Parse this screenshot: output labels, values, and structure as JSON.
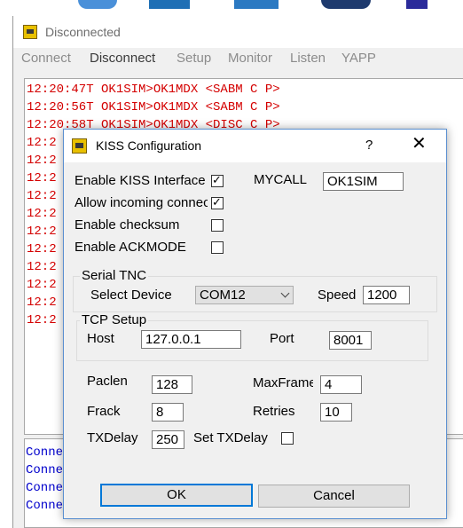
{
  "main_window": {
    "title": "Disconnected",
    "menu": [
      "Connect",
      "Disconnect",
      "Setup",
      "Monitor",
      "Listen",
      "YAPP"
    ],
    "log_lines": [
      "12:20:47T OK1SIM>OK1MDX <SABM C P>",
      "12:20:56T OK1SIM>OK1MDX <SABM C P>",
      "12:20:58T OK1SIM>OK1MDX <DISC C P>",
      "12:2",
      "12:2",
      "12:2",
      "12:2",
      "12:2",
      "12:2",
      "12:2",
      "12:2",
      "12:2",
      "12:2",
      "12:2"
    ],
    "conn_lines": [
      "Conne",
      "Conne",
      "Conne",
      "Conne"
    ]
  },
  "dialog": {
    "title": "KISS Configuration",
    "help": "?",
    "close": "✕",
    "enable_kiss": {
      "label": "Enable KISS Interface",
      "checked": true
    },
    "allow_incoming": {
      "label": "Allow incoming connections",
      "checked": true
    },
    "enable_checksum": {
      "label": "Enable checksum",
      "checked": false
    },
    "enable_ackmode": {
      "label": "Enable ACKMODE",
      "checked": false
    },
    "mycall_label": "MYCALL",
    "mycall_value": "OK1SIM",
    "serial_group": "Serial TNC",
    "select_device_label": "Select Device",
    "select_device_value": "COM12",
    "speed_label": "Speed",
    "speed_value": "1200",
    "tcp_group": "TCP  Setup",
    "host_label": "Host",
    "host_value": "127.0.0.1",
    "port_label": "Port",
    "port_value": "8001",
    "paclen_label": "Paclen",
    "paclen_value": "128",
    "maxframe_label": "MaxFrame",
    "maxframe_value": "4",
    "frack_label": "Frack",
    "frack_value": "8",
    "retries_label": "Retries",
    "retries_value": "10",
    "txdelay_label": "TXDelay",
    "txdelay_value": "250",
    "set_txdelay": {
      "label": "Set TXDelay",
      "checked": false
    },
    "ok_label": "OK",
    "cancel_label": "Cancel"
  },
  "colors": {
    "log_text": "#d40000",
    "conn_text": "#0000cc",
    "dialog_border": "#5a8fd0",
    "default_button_border": "#0078d7"
  }
}
